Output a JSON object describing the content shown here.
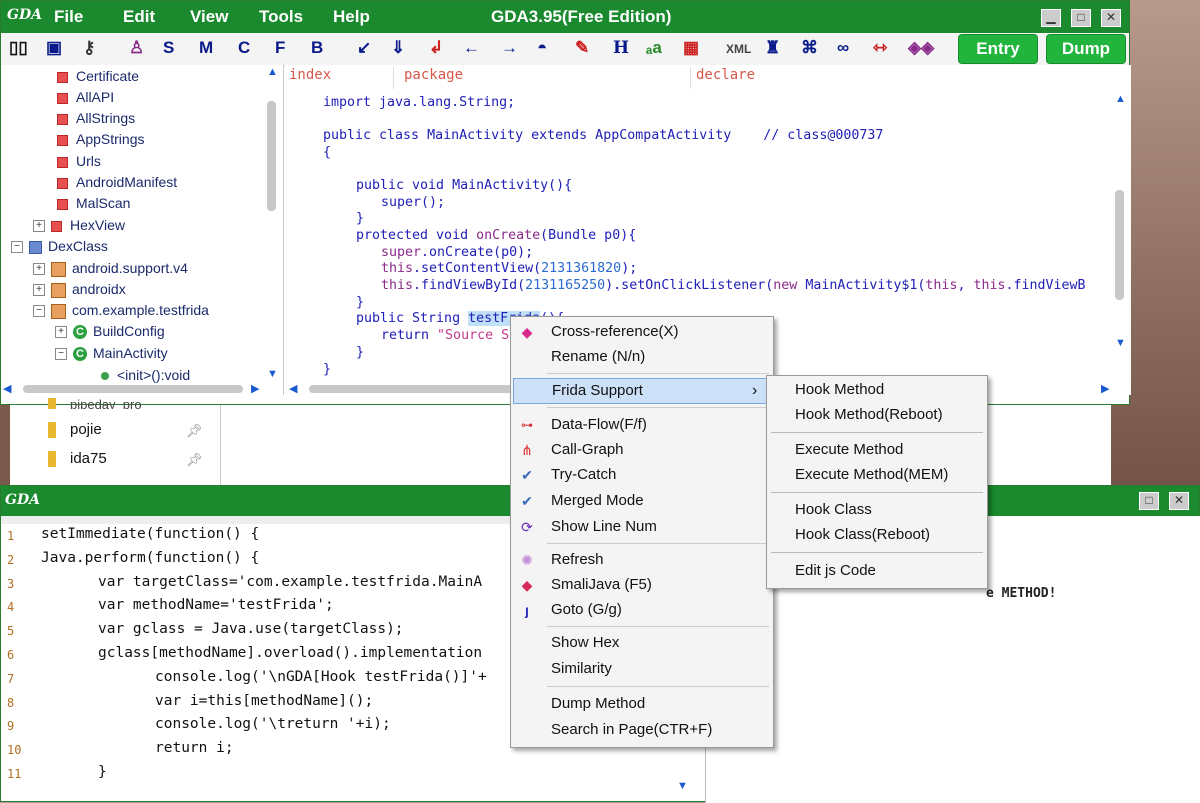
{
  "app": {
    "logo": "GDA",
    "title": "GDA3.95(Free Edition)",
    "menus": [
      "File",
      "Edit",
      "View",
      "Tools",
      "Help"
    ],
    "window_buttons": {
      "minimize": "▁",
      "maximize": "□",
      "close": "✕"
    }
  },
  "toolbar": {
    "letter_buttons": [
      "S",
      "M",
      "C",
      "F",
      "B"
    ],
    "h_button": "H",
    "entry_label": "Entry",
    "dump_label": "Dump"
  },
  "tree": {
    "items": [
      {
        "label": "Certificate"
      },
      {
        "label": "AllAPI"
      },
      {
        "label": "AllStrings"
      },
      {
        "label": "AppStrings"
      },
      {
        "label": "Urls"
      },
      {
        "label": "AndroidManifest"
      },
      {
        "label": "MalScan"
      },
      {
        "label": "HexView"
      },
      {
        "label": "DexClass"
      },
      {
        "label": "android.support.v4"
      },
      {
        "label": "androidx"
      },
      {
        "label": "com.example.testfrida"
      },
      {
        "label": "BuildConfig"
      },
      {
        "label": "MainActivity"
      },
      {
        "label": "<init>():void"
      }
    ]
  },
  "code_view": {
    "headers": {
      "index": "index",
      "package": "package",
      "declare": "declare"
    },
    "lines": {
      "l1": "import java.lang.String;",
      "l2a": "public class MainActivity extends AppCompatActivity",
      "l2b": "// class@000737",
      "l3": "{",
      "l4": "public void MainActivity(){",
      "l5": "super();",
      "l6": "}",
      "l7a": "protected void ",
      "l7b": "onCreate",
      "l7c": "(Bundle p0){",
      "l8a": "super",
      "l8b": ".onCreate(p0);",
      "l9a": "this",
      "l9b": ".setContentView(",
      "l9c": "2131361820",
      "l9d": ");",
      "l10a": "this",
      "l10b": ".findViewById(",
      "l10c": "2131165250",
      "l10d": ").setOnClickListener(",
      "l10e": "new",
      "l10f": " MainActivity$1(",
      "l10g": "this",
      "l10h": ", ",
      "l10i": "this",
      "l10j": ".findViewB",
      "l11": "}",
      "l12a": "public String ",
      "l12b": "testFr",
      "l12c": "ida",
      "l12d": "(){",
      "l13a": "return ",
      "l13b": "\"Source S",
      "l14": "}",
      "l15": "}"
    }
  },
  "explorer": {
    "items": [
      {
        "label": "pojie"
      },
      {
        "label": "ida75"
      }
    ],
    "partial_label": "pipeday_pro"
  },
  "script_window": {
    "lines": [
      {
        "n": "1",
        "text": "setImmediate(function() {"
      },
      {
        "n": "2",
        "text": "Java.perform(function() {"
      },
      {
        "n": "3",
        "text": "var targetClass='com.example.testfrida.MainA"
      },
      {
        "n": "4",
        "text": "var methodName='testFrida';"
      },
      {
        "n": "5",
        "text": "var gclass = Java.use(targetClass);"
      },
      {
        "n": "6",
        "text": "gclass[methodName].overload().implementation"
      },
      {
        "n": "7",
        "text": "console.log('\\nGDA[Hook testFrida()]'+"
      },
      {
        "n": "8",
        "text": "var i=this[methodName]();"
      },
      {
        "n": "9",
        "text": "console.log('\\treturn '+i);"
      },
      {
        "n": "10",
        "text": "return i;"
      },
      {
        "n": "11",
        "text": "}"
      }
    ],
    "right_text": "e METHOD!"
  },
  "context_menu": {
    "items": [
      {
        "label": "Cross-reference(X)",
        "icon": "cross-reference-icon"
      },
      {
        "label": "Rename (N/n)",
        "icon": ""
      },
      {
        "label": "Frida Support",
        "icon": "",
        "submenu": true
      },
      {
        "label": "Data-Flow(F/f)",
        "icon": "data-flow-icon"
      },
      {
        "label": "Call-Graph",
        "icon": "call-graph-icon"
      },
      {
        "label": "Try-Catch",
        "icon": "check-icon"
      },
      {
        "label": "Merged Mode",
        "icon": "check-icon"
      },
      {
        "label": "Show Line Num",
        "icon": "line-num-icon"
      },
      {
        "label": "Refresh",
        "icon": "refresh-icon"
      },
      {
        "label": "SmaliJava (F5)",
        "icon": "smali-java-icon"
      },
      {
        "label": "Goto (G/g)",
        "icon": "goto-icon"
      },
      {
        "label": "Show Hex",
        "icon": ""
      },
      {
        "label": "Similarity",
        "icon": ""
      },
      {
        "label": "Dump Method",
        "icon": ""
      },
      {
        "label": "Search in Page(CTR+F)",
        "icon": ""
      }
    ],
    "submenu_arrow": "›"
  },
  "frida_submenu": {
    "items": [
      {
        "label": "Hook Method"
      },
      {
        "label": "Hook Method(Reboot)"
      },
      {
        "label": "Execute Method"
      },
      {
        "label": "Execute Method(MEM)"
      },
      {
        "label": "Hook Class"
      },
      {
        "label": "Hook Class(Reboot)"
      },
      {
        "label": "Edit js Code"
      }
    ]
  },
  "colors": {
    "titlebar": "#1b8a2e",
    "entry_dump": "#22b53e",
    "keyword": "#2020b8",
    "string": "#c23a8a"
  }
}
